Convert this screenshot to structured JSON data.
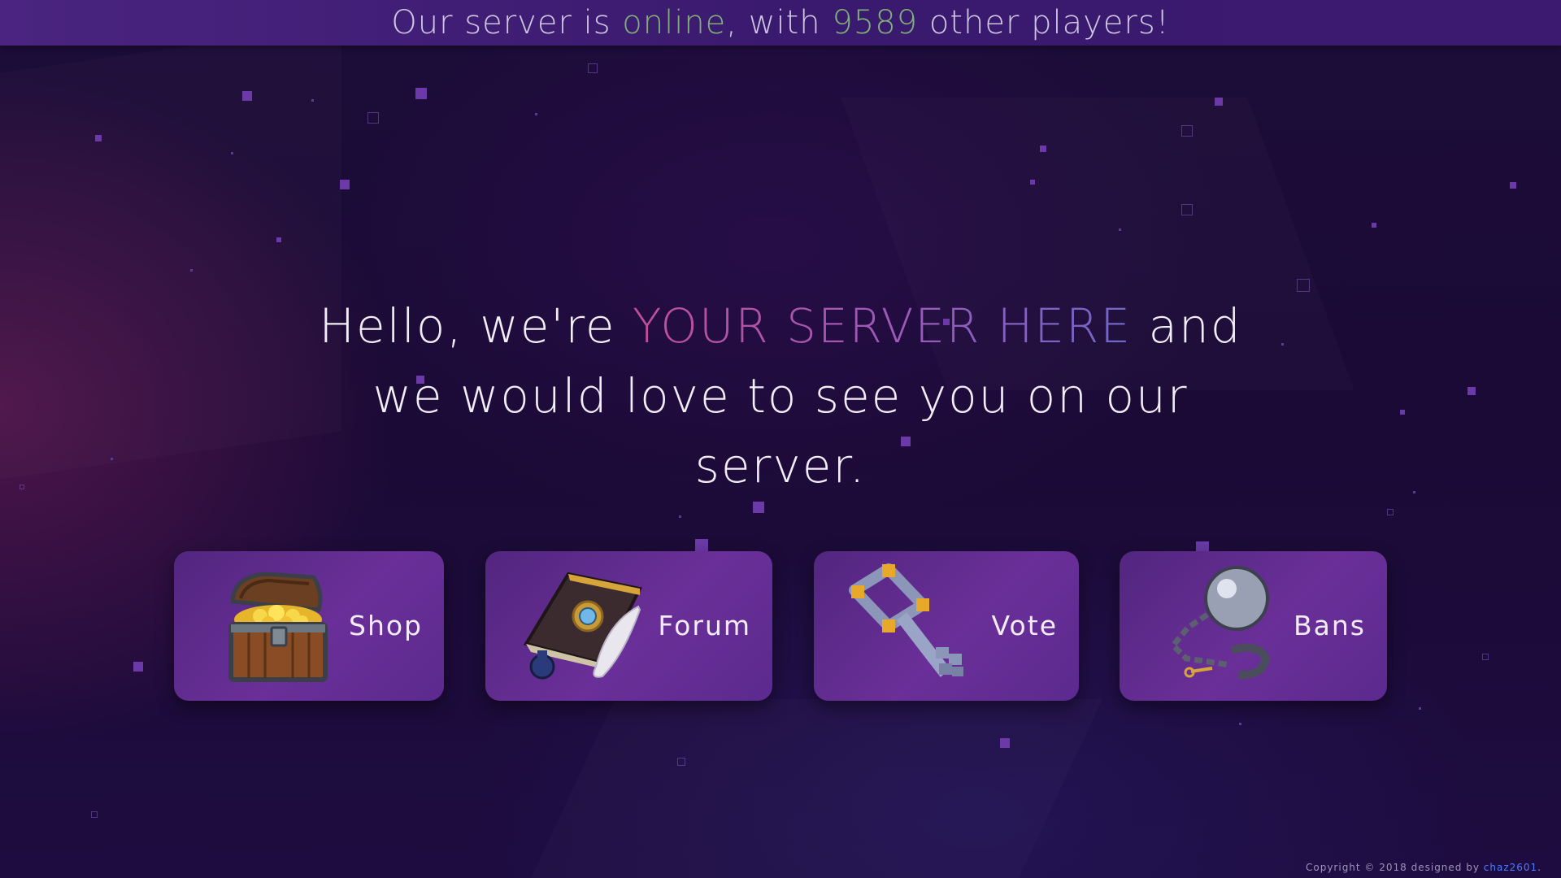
{
  "status_bar": {
    "prefix": "Our server is ",
    "status": "online",
    "middle": ", with ",
    "player_count": "9589",
    "suffix": " other players!"
  },
  "hero": {
    "prefix": "Hello, we're ",
    "server_name": "YOUR SERVER HERE",
    "suffix": " and we would love to see you on our server."
  },
  "nav_cards": [
    {
      "label": "Shop",
      "icon": "treasure-chest-icon"
    },
    {
      "label": "Forum",
      "icon": "book-quill-icon"
    },
    {
      "label": "Vote",
      "icon": "key-icon"
    },
    {
      "label": "Bans",
      "icon": "ball-and-chain-icon"
    }
  ],
  "footer": {
    "text": "Copyright © 2018 designed by ",
    "author": "chaz2601",
    "end": "."
  },
  "colors": {
    "status_green": "#7fb07a",
    "card_purple": "#5e2a8c",
    "background": "#1b0a36",
    "author_link": "#4c7dff"
  }
}
